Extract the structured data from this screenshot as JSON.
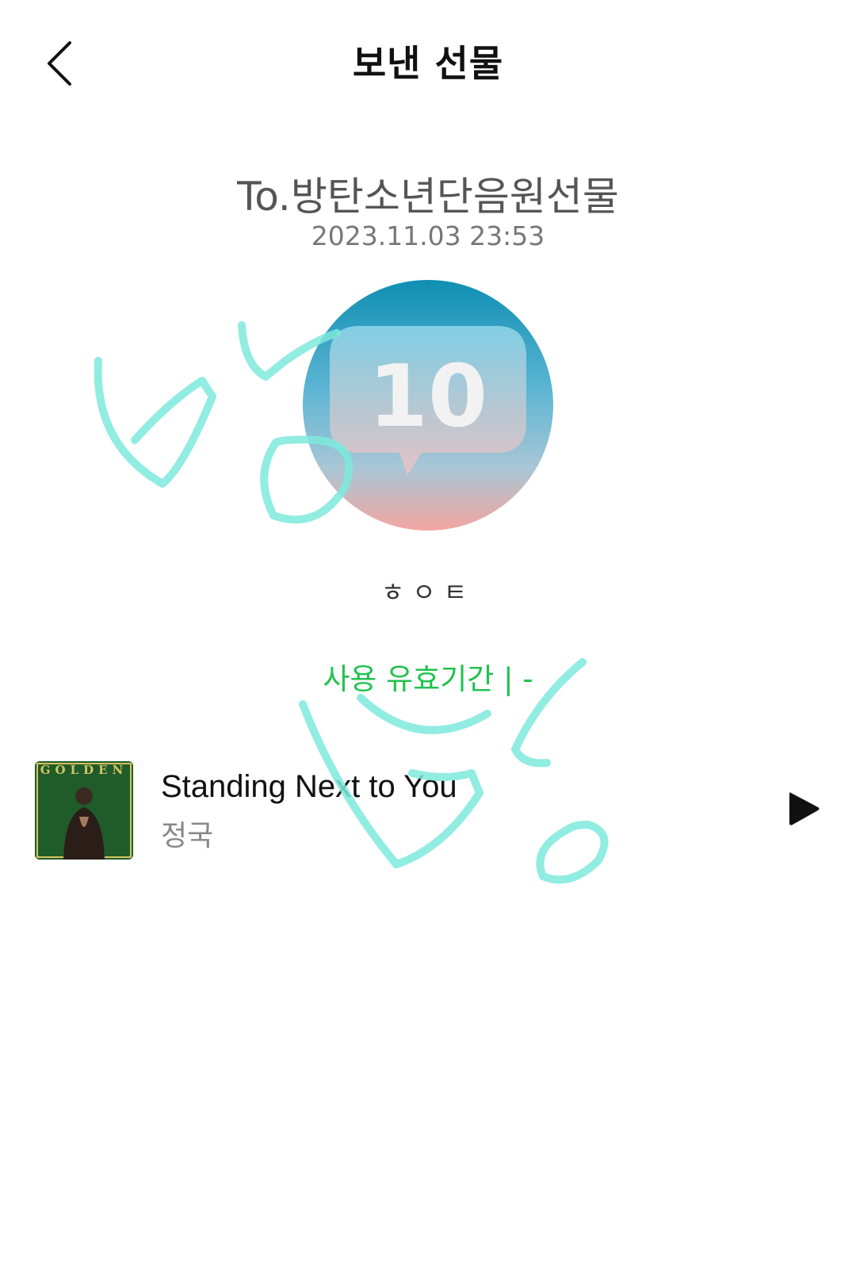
{
  "header": {
    "title": "보낸 선물",
    "back_icon": "chevron-left-icon"
  },
  "gift": {
    "recipient": "To.방탄소년단음원선물",
    "datetime": "2023.11.03 23:53",
    "image_label": "10",
    "message": "ㅎㅇㅌ",
    "validity": "사용 유효기간 |  -"
  },
  "track": {
    "title": "Standing Next to You",
    "artist": "정국",
    "album_text": "GOLDEN",
    "play_icon": "play-icon"
  },
  "colors": {
    "accent_green": "#21c24f",
    "scribble": "#7ee9dc"
  }
}
